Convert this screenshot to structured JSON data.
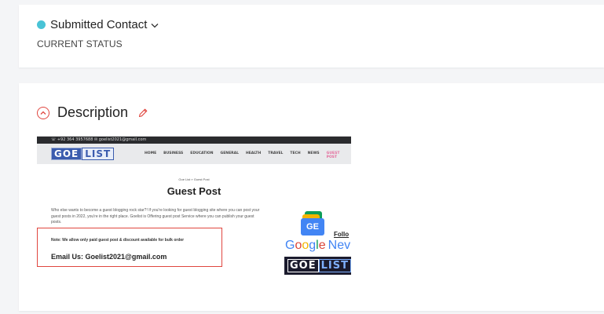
{
  "status": {
    "value": "Submitted Contact",
    "caption": "CURRENT STATUS",
    "dot_color": "#49c3d6",
    "dropdown_icon": "chevron-down-icon"
  },
  "description": {
    "title": "Description",
    "collapse_icon": "chevron-up-circle-icon",
    "edit_icon": "pencil-icon",
    "accent_color": "#e0463f",
    "embedded_screenshot": {
      "topbar_text": "☏ +92 364 3957688   ✉ goelist2021@gmail.com",
      "logo_go": "GOE",
      "logo_list": "LIST",
      "menu": [
        "HOME",
        "BUSINESS",
        "EDUCATION",
        "GENERAL",
        "HEALTH",
        "TRAVEL",
        "TECH",
        "NEWS",
        "GUEST POST"
      ],
      "breadcrumb": "Goe List » Guest Post",
      "page_title": "Guest Post",
      "intro": "Who else wants to become a guest blogging rock star?! If you're looking for guest blogging site where you can post your guest posts in 2022, you're in the right place. Goelist is Offering guest post Service where you can publish your guest posts.",
      "note": "Note: We allow only paid guest post & discount available for bulk order",
      "email": "Email Us: Goelist2021@gmail.com",
      "gnews_icon_text": "GE",
      "follow": "Follo",
      "google_letters": [
        "G",
        "o",
        "o",
        "g",
        "l",
        "e"
      ],
      "news": "Nev"
    }
  }
}
